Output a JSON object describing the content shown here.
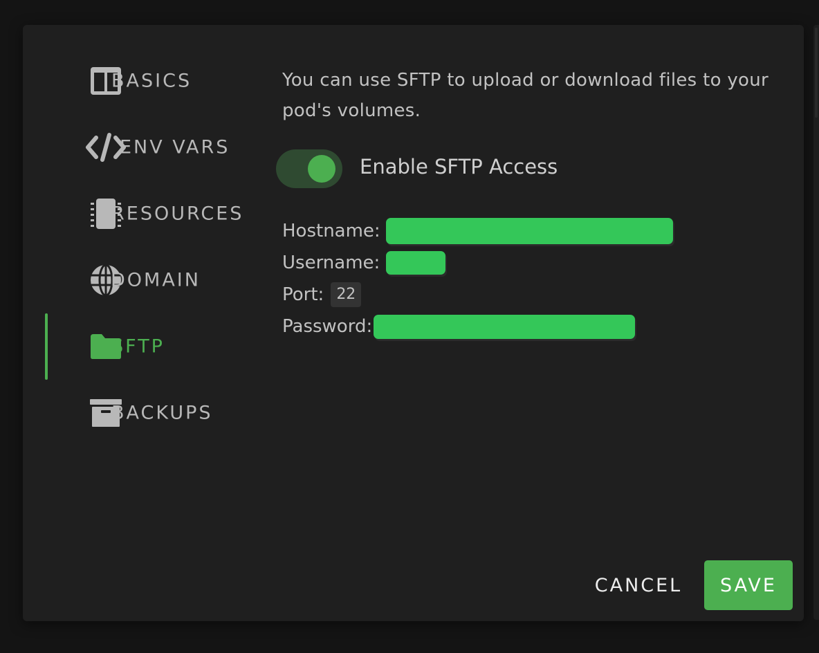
{
  "sidebar": {
    "items": [
      {
        "id": "basics",
        "label": "BASICS",
        "icon": "columns-icon"
      },
      {
        "id": "env-vars",
        "label": "ENV VARS",
        "icon": "code-icon"
      },
      {
        "id": "resources",
        "label": "RESOURCES",
        "icon": "chip-icon"
      },
      {
        "id": "domain",
        "label": "DOMAIN",
        "icon": "globe-icon"
      },
      {
        "id": "sftp",
        "label": "SFTP",
        "icon": "folder-icon",
        "active": true
      },
      {
        "id": "backups",
        "label": "BACKUPS",
        "icon": "archive-icon"
      }
    ]
  },
  "sftp": {
    "intro": "You can use SFTP to upload or download files to your pod's volumes.",
    "toggle_label": "Enable SFTP Access",
    "toggle_on": true,
    "hostname_label": "Hostname:",
    "username_label": "Username:",
    "port_label": "Port:",
    "port_value": "22",
    "password_label": "Password:"
  },
  "actions": {
    "cancel_label": "CANCEL",
    "save_label": "SAVE"
  },
  "colors": {
    "accent": "#4caf50",
    "masked": "#34c759",
    "background": "#1f1f1f"
  }
}
